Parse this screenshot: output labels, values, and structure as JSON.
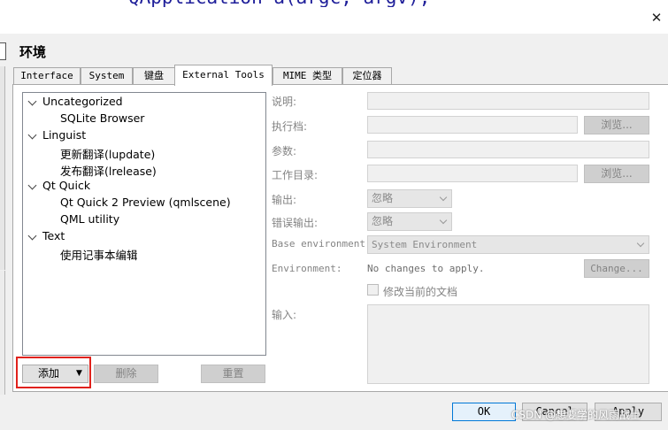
{
  "code_fragment": "QApplication a(argc, argv);",
  "window": {
    "close_glyph": "✕"
  },
  "page_title": "环境",
  "tabs": [
    {
      "label": "Interface",
      "active": false
    },
    {
      "label": "System",
      "active": false
    },
    {
      "label": "键盘",
      "active": false
    },
    {
      "label": "External Tools",
      "active": true
    },
    {
      "label": "MIME 类型",
      "active": false
    },
    {
      "label": "定位器",
      "active": false
    }
  ],
  "tree": {
    "groups": [
      {
        "label": "Uncategorized",
        "items": [
          "SQLite Browser"
        ]
      },
      {
        "label": "Linguist",
        "items": [
          "更新翻译(lupdate)",
          "发布翻译(lrelease)"
        ]
      },
      {
        "label": "Qt Quick",
        "items": [
          "Qt Quick 2 Preview (qmlscene)",
          "QML utility"
        ]
      },
      {
        "label": "Text",
        "items": [
          "使用记事本编辑"
        ]
      }
    ]
  },
  "tree_buttons": {
    "add": "添加",
    "remove": "删除",
    "reset": "重置"
  },
  "form": {
    "description_label": "说明:",
    "executable_label": "执行档:",
    "browse_label": "浏览...",
    "arguments_label": "参数:",
    "workdir_label": "工作目录:",
    "output_label": "输出:",
    "output_value": "忽略",
    "error_output_label": "错误输出:",
    "error_output_value": "忽略",
    "base_env_label": "Base environment:",
    "base_env_value": "System Environment",
    "env_label": "Environment:",
    "env_value": "No changes to apply.",
    "change_label": "Change...",
    "modify_doc_label": "修改当前的文档",
    "input_label": "输入:"
  },
  "dialog_buttons": {
    "ok": "OK",
    "cancel": "Cancel",
    "apply": "Apply"
  },
  "watermark": "CSDN @想要学的风雨战士",
  "colors": {
    "highlight_border": "#e0211b",
    "ok_border": "#0078d7"
  }
}
